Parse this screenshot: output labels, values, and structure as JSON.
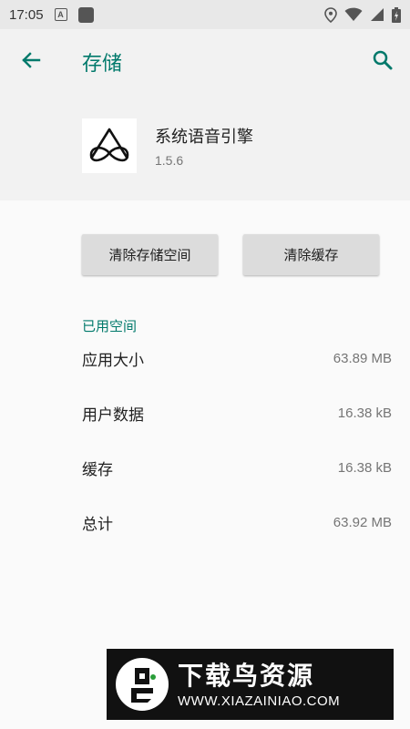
{
  "status_bar": {
    "time": "17:05",
    "notification_a_label": "A"
  },
  "toolbar": {
    "title": "存储"
  },
  "app": {
    "name": "系统语音引擎",
    "version": "1.5.6"
  },
  "actions": {
    "clear_storage": "清除存储空间",
    "clear_cache": "清除缓存"
  },
  "storage": {
    "section_title": "已用空间",
    "rows": [
      {
        "label": "应用大小",
        "value": "63.89 MB"
      },
      {
        "label": "用户数据",
        "value": "16.38 kB"
      },
      {
        "label": "缓存",
        "value": "16.38 kB"
      },
      {
        "label": "总计",
        "value": "63.92 MB"
      }
    ]
  },
  "watermark": {
    "title": "下载鸟资源",
    "url": "WWW.XIAZAINIAO.COM"
  },
  "colors": {
    "accent": "#00796b",
    "status_bar": "#e8e8e8",
    "header_bg": "#f2f2f2",
    "button_bg": "#dcdcdc"
  },
  "icons": {
    "back": "arrow-back-icon",
    "search": "search-icon",
    "location": "location-icon",
    "wifi": "wifi-icon",
    "signal": "signal-icon",
    "battery": "battery-icon"
  }
}
